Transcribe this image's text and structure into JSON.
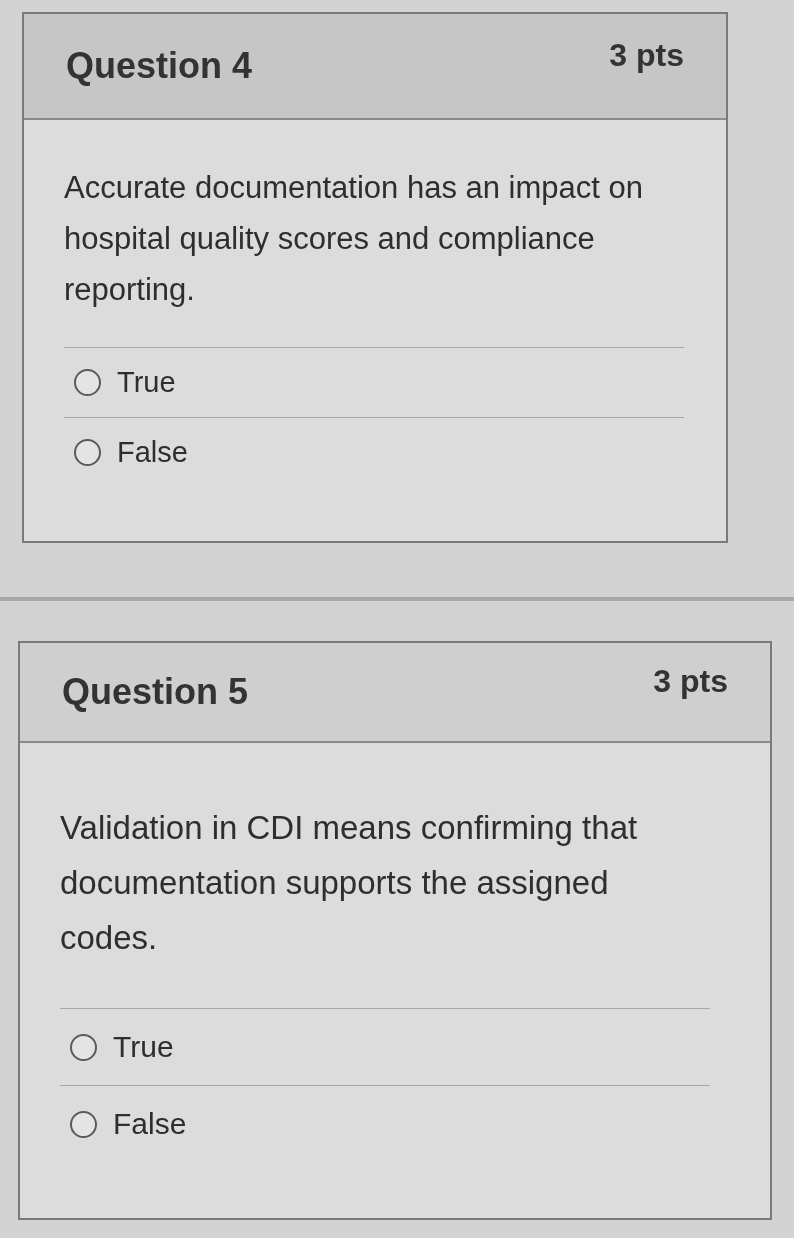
{
  "questions": [
    {
      "title": "Question 4",
      "points": "3 pts",
      "text": "Accurate documentation has an impact on hospital quality scores and compliance reporting.",
      "options": [
        {
          "label": "True",
          "selected": false
        },
        {
          "label": "False",
          "selected": false
        }
      ]
    },
    {
      "title": "Question 5",
      "points": "3 pts",
      "text": "Validation in CDI means confirming that documentation supports the assigned codes.",
      "options": [
        {
          "label": "True",
          "selected": false
        },
        {
          "label": "False",
          "selected": false
        }
      ]
    }
  ]
}
